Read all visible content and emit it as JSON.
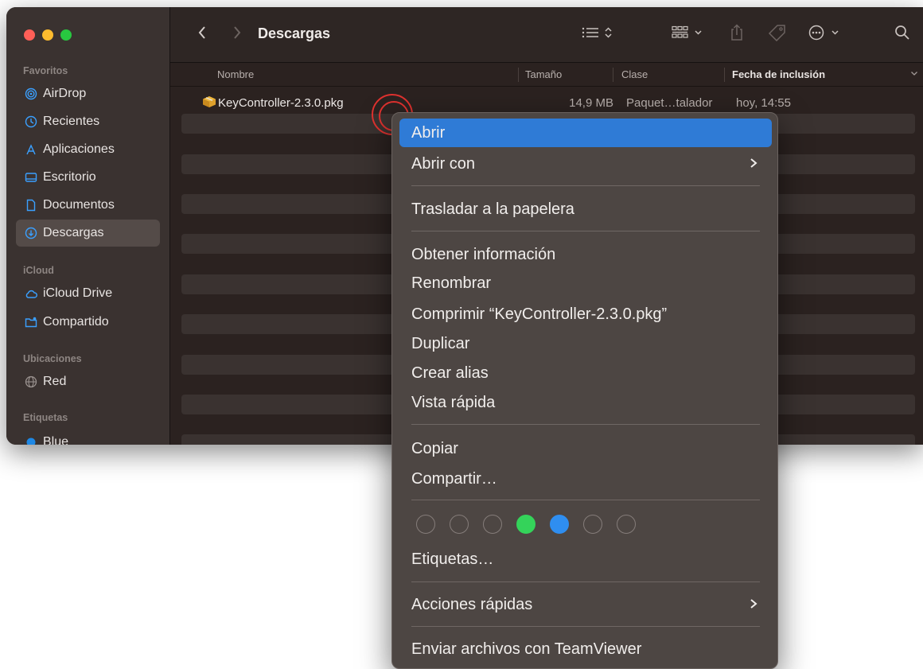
{
  "window": {
    "title": "Descargas"
  },
  "sidebar": {
    "sections": [
      {
        "label": "Favoritos"
      },
      {
        "label": "iCloud"
      },
      {
        "label": "Ubicaciones"
      },
      {
        "label": "Etiquetas"
      }
    ],
    "favorites": [
      {
        "label": "AirDrop",
        "icon": "airdrop-icon"
      },
      {
        "label": "Recientes",
        "icon": "clock-icon"
      },
      {
        "label": "Aplicaciones",
        "icon": "applications-icon"
      },
      {
        "label": "Escritorio",
        "icon": "desktop-icon"
      },
      {
        "label": "Documentos",
        "icon": "document-icon"
      },
      {
        "label": "Descargas",
        "icon": "download-icon",
        "selected": true
      }
    ],
    "icloud": [
      {
        "label": "iCloud Drive",
        "icon": "cloud-icon"
      },
      {
        "label": "Compartido",
        "icon": "shared-folder-icon"
      }
    ],
    "locations": [
      {
        "label": "Red",
        "icon": "network-icon"
      }
    ],
    "tags": [
      {
        "label": "Blue",
        "color": "#1e88e5"
      }
    ]
  },
  "columns": {
    "name": "Nombre",
    "size": "Tamaño",
    "kind": "Clase",
    "date": "Fecha de inclusión"
  },
  "files": [
    {
      "name": "KeyController-2.3.0.pkg",
      "size": "14,9 MB",
      "kind": "Paquet…talador",
      "date": "hoy, 14:55",
      "icon": "package-icon"
    }
  ],
  "menu": {
    "items": [
      {
        "label": "Abrir"
      },
      {
        "label": "Abrir con"
      },
      {
        "label": "Trasladar a la papelera"
      },
      {
        "label": "Obtener información"
      },
      {
        "label": "Renombrar"
      },
      {
        "label": "Comprimir “KeyController-2.3.0.pkg”"
      },
      {
        "label": "Duplicar"
      },
      {
        "label": "Crear alias"
      },
      {
        "label": "Vista rápida"
      },
      {
        "label": "Copiar"
      },
      {
        "label": "Compartir…"
      },
      {
        "label": "Etiquetas…"
      },
      {
        "label": "Acciones rápidas"
      },
      {
        "label": "Enviar archivos con TeamViewer"
      }
    ],
    "tag_colors": [
      "none",
      "none",
      "none",
      "#34d35a",
      "#2f8ef0",
      "none",
      "none"
    ],
    "highlight_color": "#2f7bd6"
  }
}
